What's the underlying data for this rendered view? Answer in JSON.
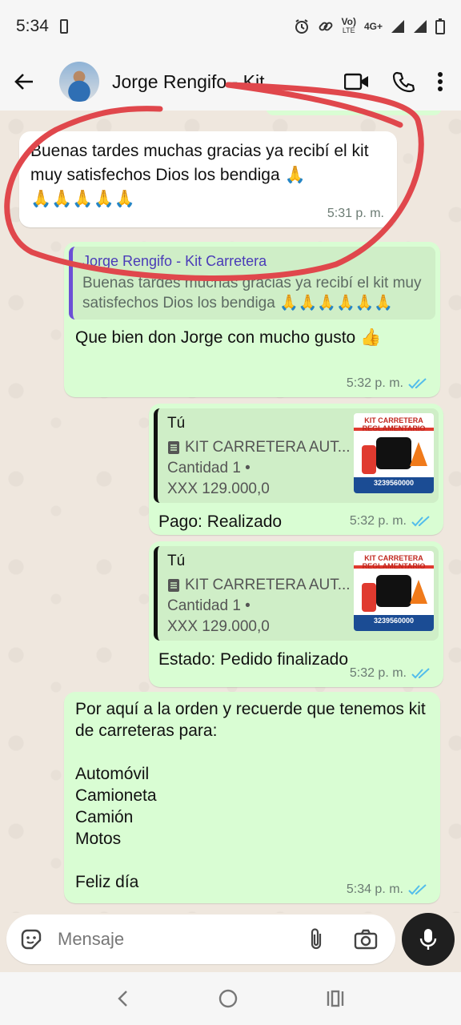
{
  "status_bar": {
    "time": "5:34",
    "net_top": "Vo)",
    "net_bottom": "LTE",
    "net_type": "4G+"
  },
  "header": {
    "contact_name": "Jorge Rengifo - Kit Carretera"
  },
  "messages": {
    "m1": {
      "text": "Buenas tardes muchas gracias ya recibí el kit muy satisfechos Dios los bendiga 🙏\n🙏🙏🙏🙏🙏",
      "time": "5:31 p. m."
    },
    "m2": {
      "quote_author": "Jorge Rengifo - Kit Carretera",
      "quote_text": "Buenas tardes muchas gracias ya recibí el kit muy satisfechos Dios los bendiga 🙏🙏🙏🙏🙏🙏",
      "text": "Que bien don Jorge con mucho gusto 👍",
      "time": "5:32 p. m."
    },
    "m3": {
      "from": "Tú",
      "product": "KIT CARRETERA AUT...",
      "quantity": "Cantidad 1 •",
      "price": "XXX 129.000,0",
      "status": "Pago: Realizado",
      "time": "5:32 p. m."
    },
    "m4": {
      "from": "Tú",
      "product": "KIT CARRETERA AUT...",
      "quantity": "Cantidad 1 •",
      "price": "XXX 129.000,0",
      "status": "Estado: Pedido finalizado",
      "time": "5:32 p. m."
    },
    "m5": {
      "text": "Por aquí a la orden y recuerde que tenemos kit de carreteras para:\n\nAutomóvil\nCamioneta\nCamión\nMotos\n\nFeliz día",
      "time": "5:34 p. m."
    }
  },
  "thumbnail": {
    "title": "KIT CARRETERA REGLAMENTARIO",
    "phone": "3239560000"
  },
  "input": {
    "placeholder": "Mensaje"
  },
  "colors": {
    "outgoing_bubble": "#d9fdd3",
    "incoming_bubble": "#ffffff",
    "read_ticks": "#53bdeb",
    "annotation": "#e0474c"
  }
}
